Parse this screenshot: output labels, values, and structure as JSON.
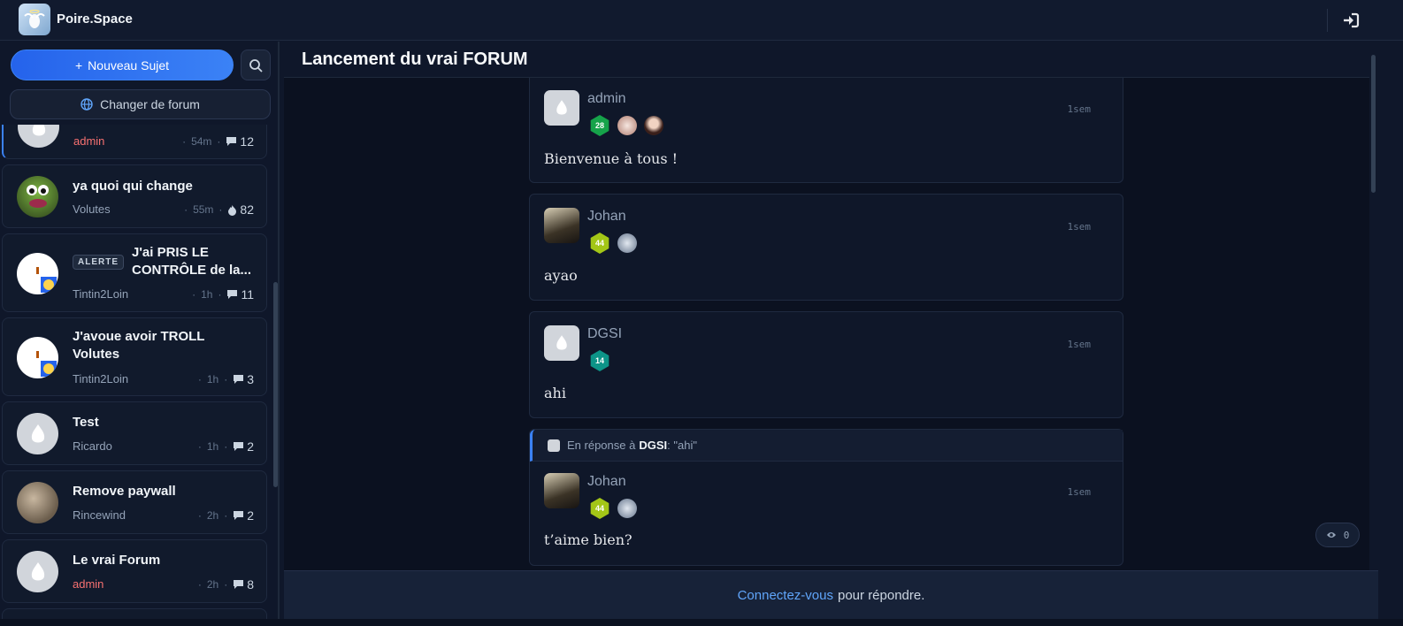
{
  "app": {
    "brand": "Poire.Space",
    "logo_icon": "pear-angel-logo",
    "login_icon": "sign-in-icon"
  },
  "sidebar": {
    "new_topic_label": "Nouveau Sujet",
    "change_forum_label": "Changer de forum",
    "topics": [
      {
        "title": "",
        "author": "admin",
        "time": "54m",
        "count": "12",
        "count_icon": "comment-icon",
        "author_admin": true
      },
      {
        "title": "ya quoi qui change",
        "author": "Volutes",
        "time": "55m",
        "count": "82",
        "count_icon": "fire-icon"
      },
      {
        "badge": "ALERTE",
        "title_line1": "J'ai PRIS LE",
        "title_line2": "CONTRÔLE de la...",
        "author": "Tintin2Loin",
        "time": "1h",
        "count": "11",
        "count_icon": "comment-icon"
      },
      {
        "title_line1": "J'avoue avoir TROLL",
        "title_line2": "Volutes",
        "author": "Tintin2Loin",
        "time": "1h",
        "count": "3",
        "count_icon": "comment-icon"
      },
      {
        "title": "Test",
        "author": "Ricardo",
        "time": "1h",
        "count": "2",
        "count_icon": "comment-icon"
      },
      {
        "title": "Remove paywall",
        "author": "Rincewind",
        "time": "2h",
        "count": "2",
        "count_icon": "comment-icon"
      },
      {
        "title": "Le vrai Forum",
        "author": "admin",
        "time": "2h",
        "count": "8",
        "count_icon": "comment-icon",
        "author_admin": true
      }
    ]
  },
  "main": {
    "title": "Lancement du vrai FORUM",
    "posts": [
      {
        "author": "admin",
        "time": "1sem",
        "level": "28",
        "level_color": "#16a34a",
        "body": "Bienvenue à tous !"
      },
      {
        "author": "Johan",
        "time": "1sem",
        "level": "44",
        "level_color": "#a3c617",
        "body": "ayao"
      },
      {
        "author": "DGSI",
        "time": "1sem",
        "level": "14",
        "level_color": "#0d9488",
        "body": "ahi"
      },
      {
        "reply_prefix": "En réponse à",
        "reply_to": "DGSI",
        "reply_quote": ": \"ahi\"",
        "author": "Johan",
        "time": "1sem",
        "level": "44",
        "level_color": "#a3c617",
        "body": "t’aime bien?"
      }
    ],
    "viewers": "0"
  },
  "footer": {
    "login_link": "Connectez-vous",
    "suffix": "pour répondre."
  }
}
